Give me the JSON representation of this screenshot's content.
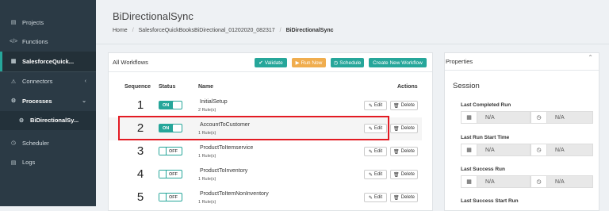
{
  "sidebar": {
    "items": [
      {
        "label": "Projects",
        "icon": "server-icon"
      },
      {
        "label": "Functions",
        "icon": "code-icon"
      },
      {
        "label": "SalesforceQuick...",
        "icon": "grid-icon"
      },
      {
        "label": "Connectors",
        "icon": "plug-icon"
      },
      {
        "label": "Processes",
        "icon": "cogs-icon"
      },
      {
        "label": "BiDirectionalSy...",
        "icon": "gear-icon"
      },
      {
        "label": "Scheduler",
        "icon": "clock-icon"
      },
      {
        "label": "Logs",
        "icon": "file-icon"
      }
    ]
  },
  "header": {
    "title": "BiDirectionalSync",
    "breadcrumb": [
      "Home",
      "SalesforceQuickBooksBiDirectional_01202020_082317",
      "BiDirectionalSync"
    ]
  },
  "workflows": {
    "title": "All Workflows",
    "buttons": {
      "validate": "Validate",
      "run_now": "Run Now",
      "schedule": "Schedule",
      "new_workflow": "Create New Workflow"
    },
    "columns": {
      "sequence": "Sequence",
      "status": "Status",
      "name": "Name",
      "actions": "Actions"
    },
    "edit_label": "Edit",
    "delete_label": "Delete",
    "rows": [
      {
        "seq": "1",
        "status": "ON",
        "name": "InitialSetup",
        "rules": "2 Rule(s)"
      },
      {
        "seq": "2",
        "status": "ON",
        "name": "AccountToCustomer",
        "rules": "1 Rule(s)"
      },
      {
        "seq": "3",
        "status": "OFF",
        "name": "ProductToItemservice",
        "rules": "1 Rule(s)"
      },
      {
        "seq": "4",
        "status": "OFF",
        "name": "ProductToInventory",
        "rules": "1 Rule(s)"
      },
      {
        "seq": "5",
        "status": "OFF",
        "name": "ProductToItemNonInventory",
        "rules": "1 Rule(s)"
      }
    ]
  },
  "properties": {
    "title": "Properties",
    "section": "Session",
    "fields": [
      {
        "label": "Last Completed Run",
        "date": "N/A",
        "time": "N/A"
      },
      {
        "label": "Last Run Start Time",
        "date": "N/A",
        "time": "N/A"
      },
      {
        "label": "Last Success Run",
        "date": "N/A",
        "time": "N/A"
      },
      {
        "label": "Last Success Start Run"
      }
    ]
  },
  "colors": {
    "accent": "#26a69a",
    "orange": "#f0ad4e",
    "highlight": "#e31b23",
    "sidebar": "#2b3a45"
  }
}
